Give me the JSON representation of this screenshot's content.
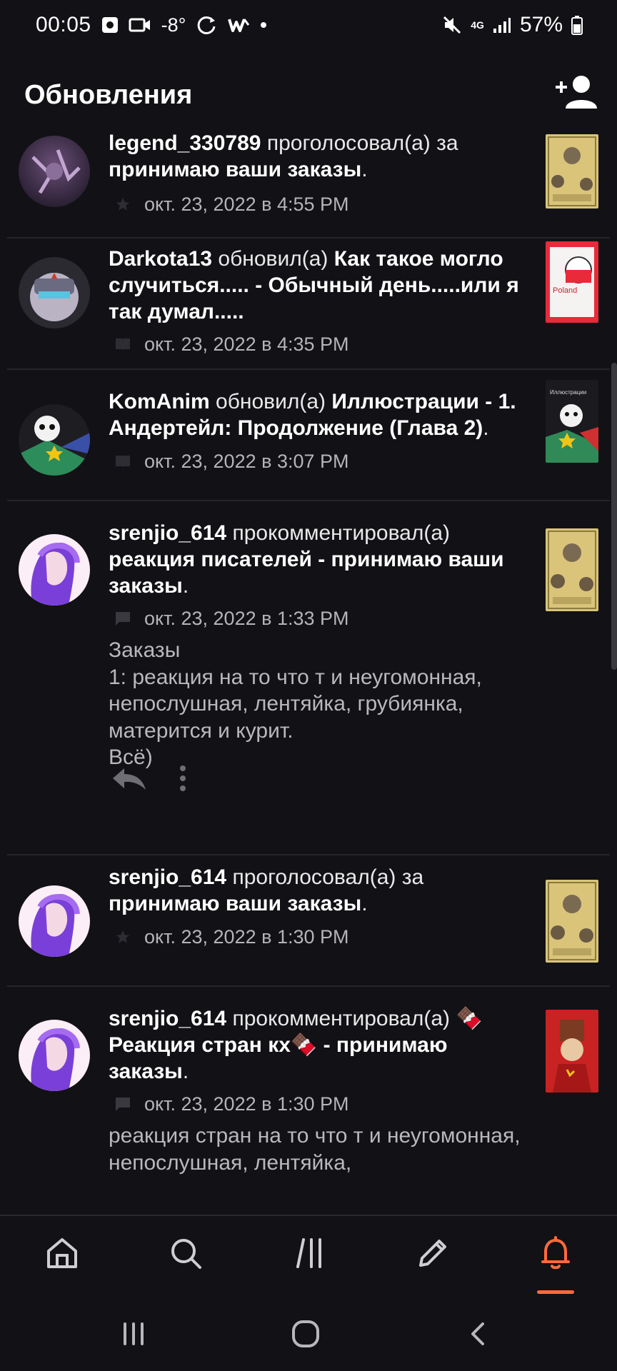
{
  "status_bar": {
    "time": "00:05",
    "temperature": "-8°",
    "network": "4G",
    "battery": "57%"
  },
  "header": {
    "title": "Обновления"
  },
  "feed": [
    {
      "user": "legend_330789",
      "action": "проголосовал(а) за",
      "story": "принимаю ваши заказы",
      "end": ".",
      "meta_icon": "star-icon",
      "timestamp": "окт. 23, 2022 в 4:55 PM"
    },
    {
      "user": "Darkota13",
      "action": "обновил(а)",
      "story": "Как такое могло случиться..... - Обычный день.....или я так думал.....",
      "end": "",
      "meta_icon": "book-icon",
      "timestamp": "окт. 23, 2022 в 4:35 PM",
      "thumb_label": "Poland"
    },
    {
      "user": "KomAnim",
      "action": "обновил(а)",
      "story": "Иллюстрации - 1. Андертейл: Продолжение (Глава 2)",
      "end": ".",
      "meta_icon": "book-icon",
      "timestamp": "окт. 23, 2022 в 3:07 PM",
      "thumb_label": "Иллюстрации"
    },
    {
      "user": "srenjio_614",
      "action": "прокомментировал(а)",
      "story": "реакция писателей - принимаю ваши заказы",
      "end": ".",
      "meta_icon": "comment-icon",
      "timestamp": "окт. 23, 2022 в 1:33 PM",
      "comment": "Заказы\n1: реакция на то что т и неугомонная, непослушная, лентяйка, грубиянка, матерится и курит.\nВсё)"
    },
    {
      "user": "srenjio_614",
      "action": "проголосовал(а) за",
      "story": "принимаю ваши заказы",
      "end": ".",
      "meta_icon": "star-icon",
      "timestamp": "окт. 23, 2022 в 1:30 PM"
    },
    {
      "user": "srenjio_614",
      "action": "прокомментировал(а)",
      "story": "🍫Реакция стран кх🍫 - принимаю заказы",
      "end": ".",
      "meta_icon": "comment-icon",
      "timestamp": "окт. 23, 2022 в 1:30 PM",
      "comment": "реакция стран на то что т и неугомонная, непослушная, лентяйка,"
    }
  ],
  "bottom_nav": [
    "home-icon",
    "search-icon",
    "library-icon",
    "write-icon",
    "notifications-icon"
  ],
  "colors": {
    "background": "#121115",
    "accent": "#ff6a3d",
    "text_primary": "#ffffff",
    "text_secondary": "#b5b4b8"
  }
}
